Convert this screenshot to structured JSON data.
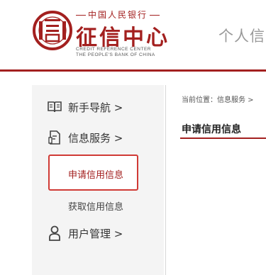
{
  "header": {
    "brand_small": "中国人民银行",
    "brand_big": "征信中心",
    "brand_en_line1": "CREDIT REFERENCE CENTER",
    "brand_en_line2": "THE PEOPLE'S BANK OF CHINA",
    "right_text": "个人信",
    "accent_color": "#a3201f"
  },
  "sidebar": {
    "items": [
      {
        "label": "新手导航 >",
        "icon": "book-icon"
      },
      {
        "label": "信息服务 >",
        "icon": "document-icon"
      },
      {
        "label": "用户管理 >",
        "icon": "user-icon"
      }
    ],
    "sub_items": [
      {
        "label": "申请信用信息",
        "active": true
      },
      {
        "label": "获取信用信息",
        "active": false
      }
    ]
  },
  "content": {
    "breadcrumb": "当前位置：信息服务 > ",
    "title": "申请信用信息"
  }
}
